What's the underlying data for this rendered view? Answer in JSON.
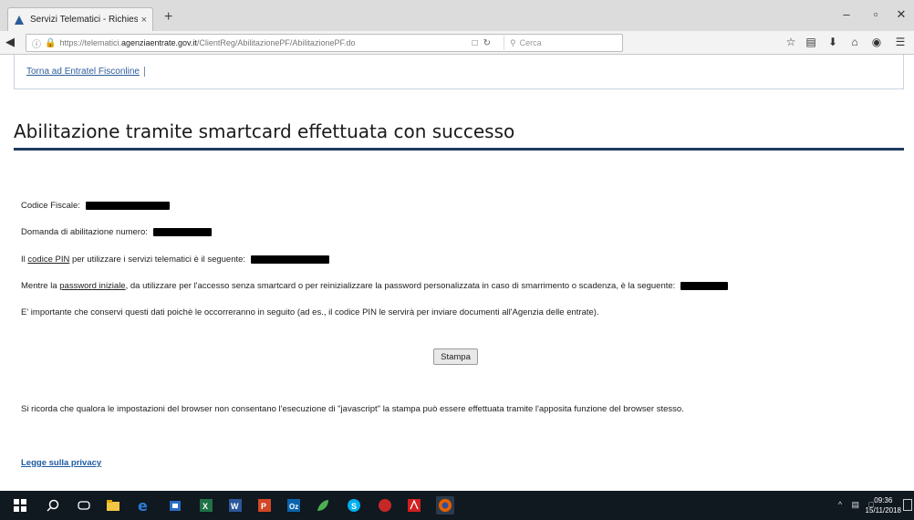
{
  "browser": {
    "tab_title": "Servizi Telematici - Richiesta",
    "tab_close": "×",
    "new_tab": "+",
    "url_host_prefix": "https://telematici.",
    "url_host": "agenziaentrate.gov.it",
    "url_path": "/ClientReg/AbilitazionePF/AbilitazionePF.do",
    "search_placeholder": "Cerca",
    "minimize": "–",
    "maximize": "▫",
    "close": "✕"
  },
  "page": {
    "back_link": "Torna ad Entratel Fisconline",
    "title": "Abilitazione tramite smartcard effettuata con successo",
    "codice_fiscale_label": "Codice Fiscale:",
    "domanda_label": "Domanda di abilitazione numero:",
    "pin_text_before": "Il ",
    "pin_link": "codice PIN",
    "pin_text_after": " per utilizzare i servizi telematici è il seguente:",
    "password_text_before": "Mentre la ",
    "password_link": "password iniziale",
    "password_text_after": ", da utilizzare per l'accesso senza smartcard o per reinizializzare la password personalizzata in caso di smarrimento o scadenza, è la seguente:",
    "important_note": "E' importante che conservi questi dati poichè le occorreranno in seguito (ad es., il codice PIN le servirà per inviare documenti all'Agenzia delle entrate).",
    "print_button": "Stampa",
    "browser_note": "Si ricorda che qualora le impostazioni del browser non consentano l'esecuzione di \"javascript\" la stampa può essere effettuata tramite l'apposita funzione del browser stesso.",
    "privacy_link": "Legge sulla privacy"
  },
  "taskbar": {
    "time": "09:36",
    "date": "15/11/2018",
    "colors": {
      "edge": "#2b7cd3",
      "store": "#2a6cc4",
      "excel": "#1f7246",
      "word": "#2b579a",
      "powerpoint": "#d24726",
      "firefox": "#e66000",
      "acrobat": "#d21f1f"
    }
  }
}
